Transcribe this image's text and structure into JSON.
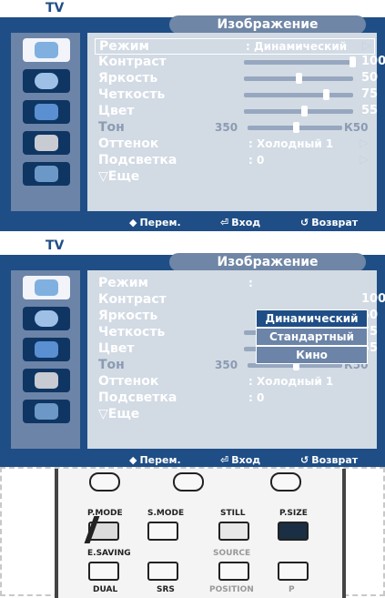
{
  "screens": [
    {
      "tv_label": "TV",
      "title": "Изображение",
      "menu": [
        {
          "label": "Режим",
          "value": ": Динамический",
          "type": "select",
          "selected": true
        },
        {
          "label": "Контраст",
          "slider": 1.0,
          "number": "100",
          "type": "slider"
        },
        {
          "label": "Яркость",
          "slider": 0.5,
          "number": "50",
          "type": "slider"
        },
        {
          "label": "Четкость",
          "slider": 0.75,
          "number": "75",
          "type": "slider"
        },
        {
          "label": "Цвет",
          "slider": 0.55,
          "number": "55",
          "type": "slider"
        },
        {
          "label": "Тон",
          "left": "350",
          "right": "К50",
          "type": "tone",
          "dim": true
        },
        {
          "label": "Оттенок",
          "value": ": Холодный 1",
          "type": "select"
        },
        {
          "label": "Подсветка",
          "value": ": 0",
          "type": "select"
        },
        {
          "label": "▽Еще",
          "type": "more"
        }
      ],
      "footer": [
        {
          "icon": "◆",
          "label": "Перем."
        },
        {
          "icon": "⏎",
          "label": "Вход"
        },
        {
          "icon": "↺",
          "label": "Возврат"
        }
      ]
    },
    {
      "tv_label": "TV",
      "title": "Изображение",
      "menu": [
        {
          "label": "Режим",
          "value": ": Динамический",
          "type": "select",
          "selected": false
        },
        {
          "label": "Контраст",
          "slider": 1.0,
          "number": "100",
          "type": "slider"
        },
        {
          "label": "Яркость",
          "slider": 0.5,
          "number": "50",
          "type": "slider"
        },
        {
          "label": "Четкость",
          "slider": 0.75,
          "number": "75",
          "type": "slider"
        },
        {
          "label": "Цвет",
          "slider": 0.55,
          "number": "55",
          "type": "slider"
        },
        {
          "label": "Тон",
          "left": "350",
          "right": "К50",
          "type": "tone",
          "dim": true
        },
        {
          "label": "Оттенок",
          "value": ": Холодный 1",
          "type": "select"
        },
        {
          "label": "Подсветка",
          "value": ": 0",
          "type": "select"
        },
        {
          "label": "▽Еще",
          "type": "more"
        }
      ],
      "dropdown": [
        "Динамический",
        "Стандартный",
        "Кино"
      ],
      "footer": [
        {
          "icon": "◆",
          "label": "Перем."
        },
        {
          "icon": "⏎",
          "label": "Вход"
        },
        {
          "icon": "↺",
          "label": "Возврат"
        }
      ]
    }
  ],
  "remote": {
    "labels": [
      "P.MODE",
      "S.MODE",
      "STILL",
      "P.SIZE",
      "E.SAVING",
      "SOURCE",
      "DUAL",
      "SRS",
      "POSITION",
      "P"
    ]
  }
}
